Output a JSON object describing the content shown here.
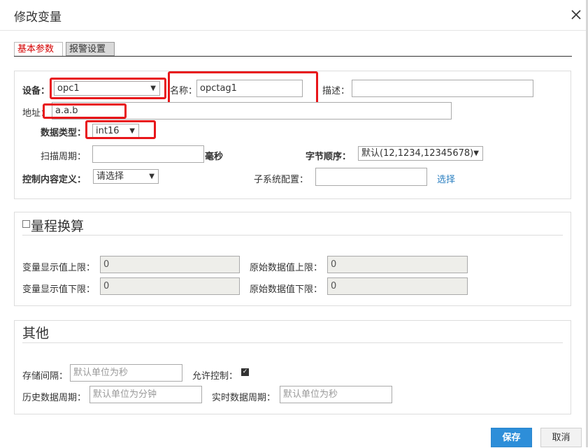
{
  "dialog": {
    "title": "修改变量",
    "close_icon": "close-icon"
  },
  "tabs": [
    {
      "label": "基本参数",
      "active": true
    },
    {
      "label": "报警设置",
      "active": false
    }
  ],
  "basic": {
    "device_label": "设备：",
    "device_value": "opc1",
    "name_label": "名称：",
    "name_value": "opctag1",
    "desc_label": "描述：",
    "desc_value": "",
    "address_label": "地址：",
    "address_value": "a.a.b",
    "datatype_label": "数据类型：",
    "datatype_value": "int16",
    "scan_label": "扫描周期：",
    "scan_value": "",
    "scan_unit": "毫秒",
    "byteorder_label": "字节顺序：",
    "byteorder_value": "默认(12,1234,12345678)",
    "control_label": "控制内容定义：",
    "control_value": "请选择",
    "subsystem_label": "子系统配置：",
    "subsystem_value": "",
    "select_link": "选择"
  },
  "range": {
    "title": "量程换算",
    "checked": false,
    "disp_upper_label": "变量显示值上限：",
    "disp_upper_value": "0",
    "raw_upper_label": "原始数据值上限：",
    "raw_upper_value": "0",
    "disp_lower_label": "变量显示值下限：",
    "disp_lower_value": "0",
    "raw_lower_label": "原始数据值下限：",
    "raw_lower_value": "0"
  },
  "other": {
    "title": "其他",
    "storage_label": "存储间隔：",
    "storage_placeholder": "默认单位为秒",
    "allow_label": "允许控制：",
    "allow_checked": true,
    "history_label": "历史数据周期：",
    "history_placeholder": "默认单位为分钟",
    "realtime_label": "实时数据周期：",
    "realtime_placeholder": "默认单位为秒"
  },
  "footer": {
    "save_label": "保存",
    "cancel_label": "取消"
  },
  "colors": {
    "primary": "#2d8ed9",
    "highlight": "#e8161a",
    "active_tab": "#d40000"
  }
}
